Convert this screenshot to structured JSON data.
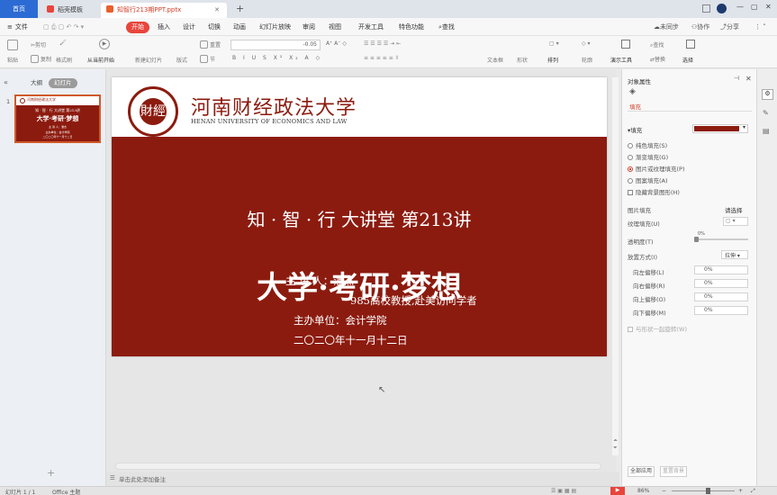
{
  "tabs": {
    "home": "首页",
    "docer": "稻壳模板",
    "doc": "知智行213期PPT.pptx"
  },
  "window": {
    "min": "—",
    "max": "▢",
    "close": "✕"
  },
  "menu": {
    "file": "文件",
    "items": [
      "开始",
      "插入",
      "设计",
      "切换",
      "动画",
      "幻灯片放映",
      "审阅",
      "视图",
      "开发工具",
      "特色功能"
    ],
    "search": "查找",
    "right": [
      "未同步",
      "协作",
      "分享"
    ]
  },
  "ribbon": {
    "paste": "粘贴",
    "cut": "剪切",
    "format_painter": "格式刷",
    "copy": "复制",
    "from_current": "从当前开始",
    "new_slide": "新建幻灯片",
    "layout": "版式",
    "reset": "重置",
    "section": "节",
    "font_size": "-0.05",
    "text_box": "文本框",
    "shape": "形状",
    "arrange": "排列",
    "outline": "轮廓",
    "find": "查找",
    "select": "选择",
    "presenter": "演示工具",
    "replace": "替换"
  },
  "left_pane": {
    "outline_tab": "大纲",
    "slides_tab": "幻灯片",
    "slide_number": "1",
    "add": "+"
  },
  "slide": {
    "university_cn": "河南财经政法大学",
    "university_en": "HENAN UNIVERSITY OF ECONOMICS AND LAW",
    "seal_text": "財經",
    "subtitle": "知 · 智 · 行  大讲堂  第213讲",
    "title": "大学·考研·梦想",
    "speaker": "主 讲 人：潘杰",
    "speaker_desc": "985高校教授,赴美访问学者",
    "organizer": "主办单位：会计学院",
    "date": "二〇二〇年十一月十二日"
  },
  "notes_placeholder": "单击此处添加备注",
  "right_pane": {
    "title": "对象属性",
    "tab": "填充",
    "fill_label": "填充",
    "fill_color": "#8c1b0f",
    "options": [
      "纯色填充(S)",
      "渐变填充(G)",
      "图片或纹理填充(P)",
      "图案填充(A)"
    ],
    "selected_option": "图片或纹理填充(P)",
    "hide_bg": "隐藏背景图形(H)",
    "picture_fill": "图片填充",
    "select_picture": "请选择",
    "texture_fill": "纹理填充(U)",
    "transparency": "透明度(T)",
    "transparency_value": "0%",
    "placement": "放置方式(I)",
    "placement_value": "拉伸",
    "offsets": [
      {
        "label": "向左偏移(L)",
        "value": "0%"
      },
      {
        "label": "向右偏移(R)",
        "value": "0%"
      },
      {
        "label": "向上偏移(O)",
        "value": "0%"
      },
      {
        "label": "向下偏移(M)",
        "value": "0%"
      }
    ],
    "rotate_with_shape": "与形状一起旋转(W)",
    "apply_all": "全部应用",
    "reset_bg": "重置背景"
  },
  "status": {
    "slide_count": "幻灯片 1 / 1",
    "theme": "Office 主题",
    "zoom": "86%"
  }
}
